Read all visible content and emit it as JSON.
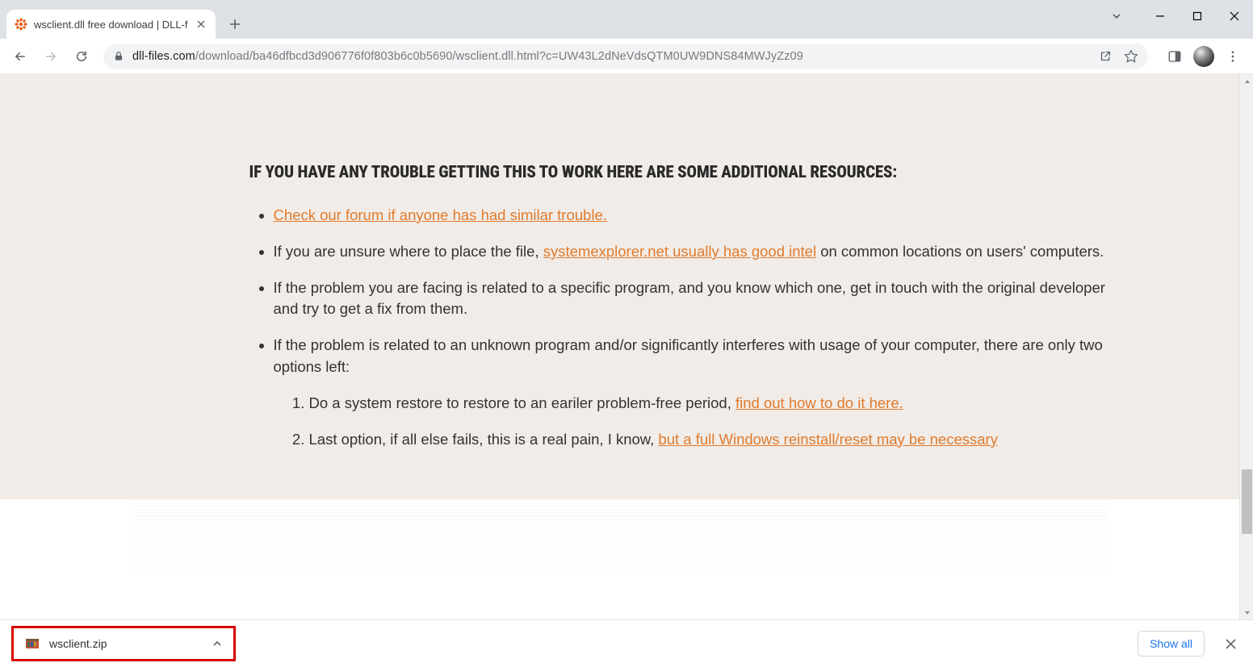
{
  "window": {
    "tab_title": "wsclient.dll free download | DLL-f"
  },
  "toolbar": {
    "url_host": "dll-files.com",
    "url_path": "/download/ba46dfbcd3d906776f0f803b6c0b5690/wsclient.dll.html?c=UW43L2dNeVdsQTM0UW9DNS84MWJyZz09"
  },
  "article": {
    "heading": "IF YOU HAVE ANY TROUBLE GETTING THIS TO WORK HERE ARE SOME ADDITIONAL RESOURCES:",
    "bullets": {
      "forum_link": "Check our forum if anyone has had similar trouble.",
      "unsure_before": "If you are unsure where to place the file, ",
      "unsure_link": "systemexplorer.net usually has good intel",
      "unsure_after": " on common locations on users' computers.",
      "specific_program": "If the problem you are facing is related to a specific program, and you know which one, get in touch with the original developer and try to get a fix from them.",
      "unknown_intro": "If the problem is related to an unknown program and/or significantly interferes with usage of your computer, there are only two options left:",
      "restore_before": "Do a system restore to restore to an eariler problem-free period, ",
      "restore_link": "find out how to do it here.",
      "reinstall_before": "Last option, if all else fails, this is a real pain, I know, ",
      "reinstall_link": "but a full Windows reinstall/reset may be necessary"
    }
  },
  "downloads": {
    "item_name": "wsclient.zip",
    "show_all": "Show all"
  }
}
